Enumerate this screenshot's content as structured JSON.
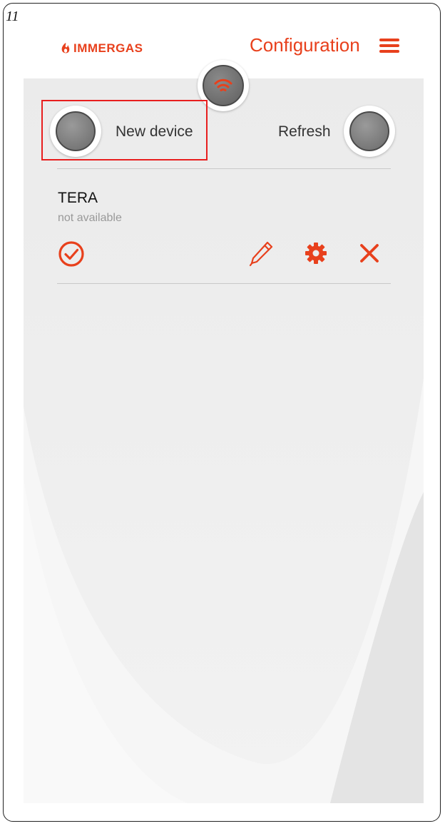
{
  "page_number": "11",
  "brand": {
    "name": "IMMERGAS"
  },
  "header": {
    "title": "Configuration"
  },
  "actions": {
    "new_device_label": "New device",
    "refresh_label": "Refresh"
  },
  "devices": [
    {
      "name": "TERA",
      "status": "not available"
    }
  ],
  "icons": {
    "wifi": "wifi-icon",
    "menu": "hamburger-menu-icon",
    "select": "check-circle-icon",
    "edit": "pencil-icon",
    "settings": "gear-icon",
    "delete": "close-icon"
  },
  "colors": {
    "accent": "#e8401c",
    "highlight": "#e81e1e",
    "panel": "#ececec"
  }
}
